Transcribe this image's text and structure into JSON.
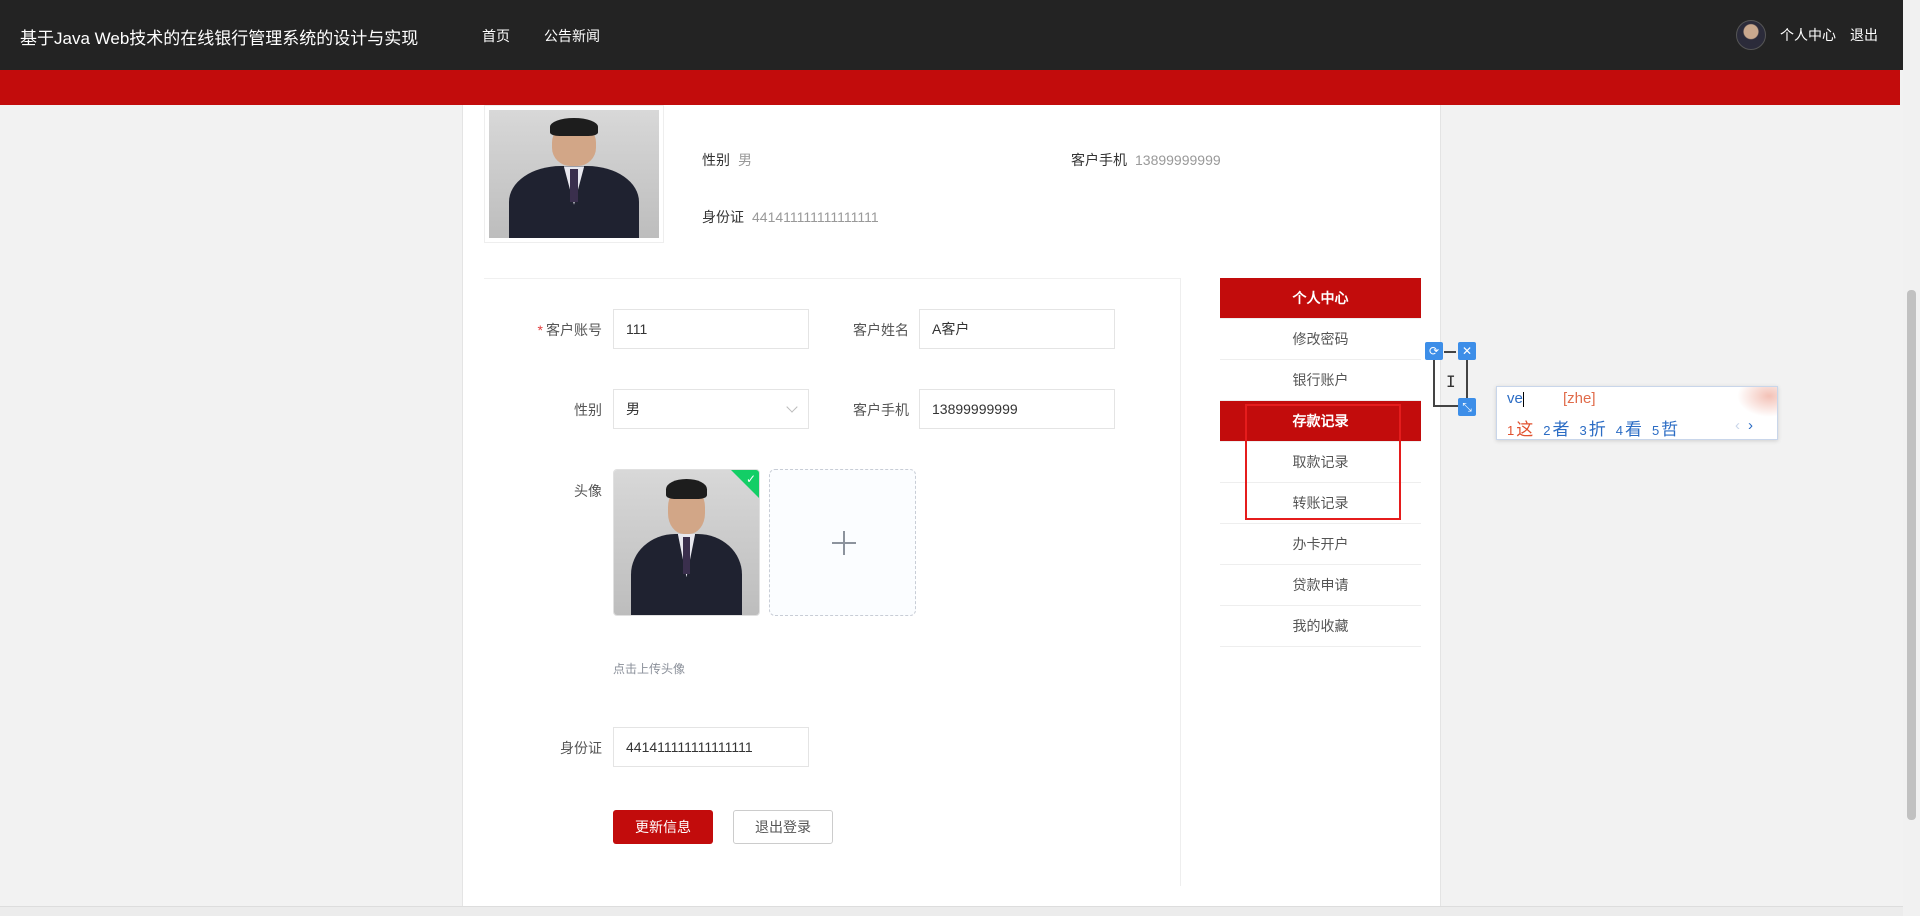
{
  "header": {
    "site_title": "基于Java Web技术的在线银行管理系统的设计与实现",
    "nav": [
      "首页",
      "公告新闻"
    ],
    "user_center": "个人中心",
    "logout": "退出"
  },
  "profile": {
    "gender_label": "性别",
    "gender_value": "男",
    "phone_label": "客户手机",
    "phone_value": "13899999999",
    "id_label": "身份证",
    "id_value": "441411111111111111"
  },
  "form": {
    "account_label": "客户账号",
    "account_value": "111",
    "name_label": "客户姓名",
    "name_value": "A客户",
    "gender_label": "性别",
    "gender_value": "男",
    "phone_label": "客户手机",
    "phone_value": "13899999999",
    "avatar_label": "头像",
    "upload_hint": "点击上传头像",
    "id_label": "身份证",
    "id_value": "441411111111111111",
    "update_button": "更新信息",
    "logout_button": "退出登录"
  },
  "side_menu": {
    "title": "个人中心",
    "items": [
      "修改密码",
      "银行账户",
      "存款记录",
      "取款记录",
      "转账记录",
      "办卡开户",
      "贷款申请",
      "我的收藏"
    ],
    "active_index": 2
  },
  "ime": {
    "input": "ve",
    "pinyin": "[zhe]",
    "candidates": [
      {
        "num": "1",
        "text": "这"
      },
      {
        "num": "2",
        "text": "者"
      },
      {
        "num": "3",
        "text": "折"
      },
      {
        "num": "4",
        "text": "看"
      },
      {
        "num": "5",
        "text": "哲"
      }
    ],
    "prev": "‹",
    "next": "›"
  },
  "colors": {
    "brand_red": "#c20c0c",
    "header_bg": "#232323",
    "highlight": "#e51c1c",
    "ime_blue": "#3d8ee8"
  }
}
